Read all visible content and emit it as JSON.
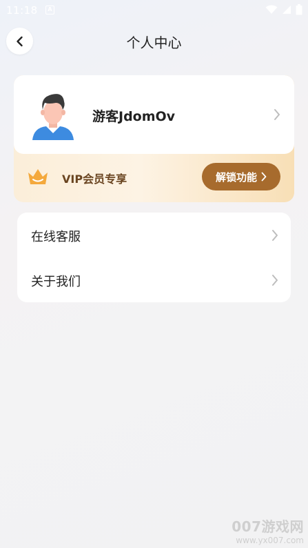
{
  "status_bar": {
    "time": "11:18",
    "notification_glyph": "A"
  },
  "header": {
    "title": "个人中心"
  },
  "profile": {
    "username": "游客JdomOv"
  },
  "vip": {
    "label": "VIP会员专享",
    "unlock_button": "解锁功能"
  },
  "menu": {
    "items": [
      {
        "label": "在线客服"
      },
      {
        "label": "关于我们"
      }
    ]
  },
  "watermark": {
    "title": "007游戏网",
    "url": "www.yx007.com"
  },
  "colors": {
    "vip_button": "#a76b2d",
    "vip_text": "#6a4521",
    "vip_gradient_start": "#fbeed9",
    "vip_gradient_end": "#f8dfb6"
  }
}
